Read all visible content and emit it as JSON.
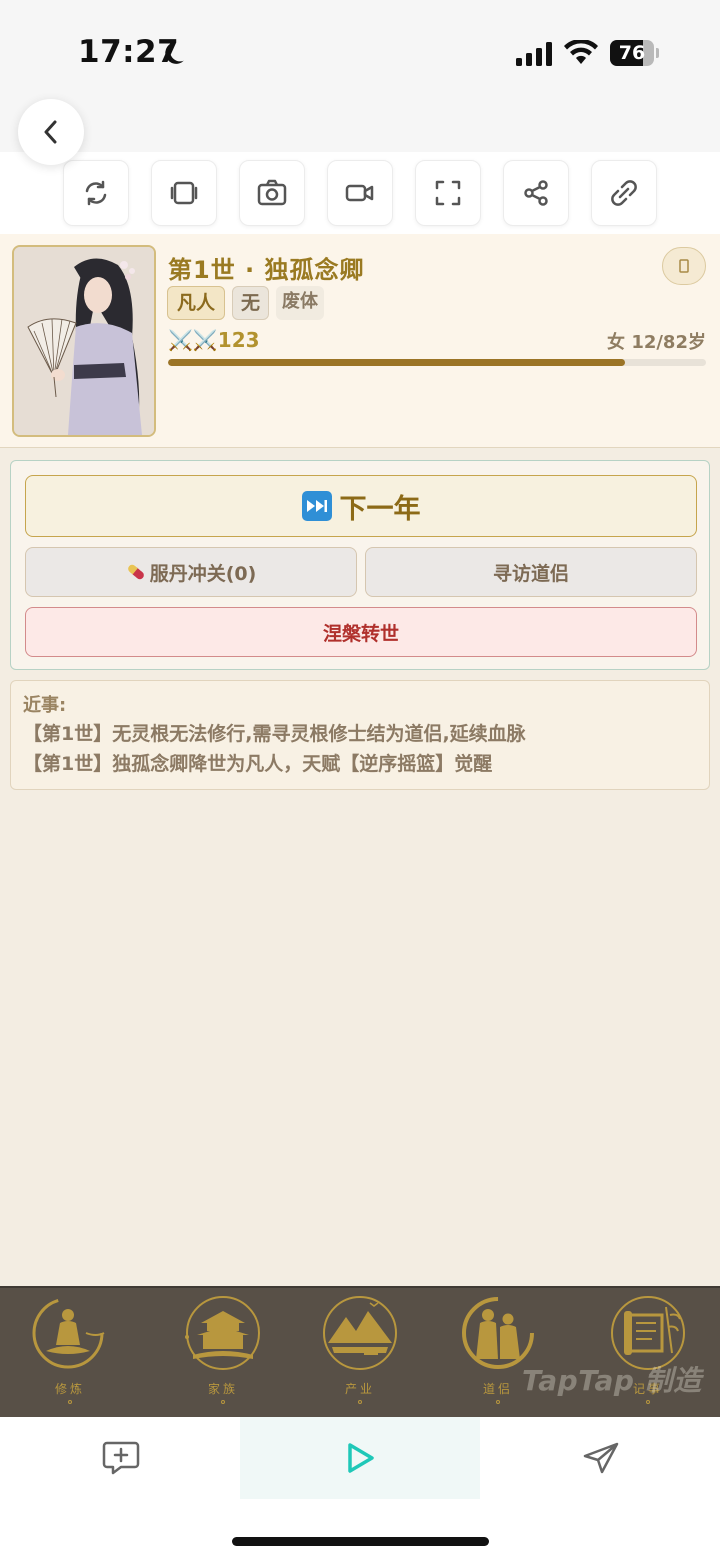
{
  "status_bar": {
    "time": "17:27",
    "battery": "76",
    "battery_level": 0.76
  },
  "profile": {
    "title": "第1世 · 独孤念卿",
    "tags": [
      "凡人",
      "无",
      "废体"
    ],
    "power": "⚔️⚔️123",
    "age": "女 12/82岁",
    "life_progress": 0.85
  },
  "actions": {
    "next_year": "下一年",
    "pill": "服丹冲关(0)",
    "seek_partner": "寻访道侣",
    "rebirth": "涅槃转世"
  },
  "events": {
    "title": "近事:",
    "lines": [
      "【第1世】无灵根无法修行,需寻灵根修士结为道侣,延续血脉",
      "【第1世】独孤念卿降世为凡人，天赋【逆序摇篮】觉醒"
    ]
  },
  "bottom_nav": {
    "items": [
      {
        "label": "修炼",
        "icon": "meditation-icon"
      },
      {
        "label": "家族",
        "icon": "pavilion-icon"
      },
      {
        "label": "产业",
        "icon": "mountain-icon"
      },
      {
        "label": "道侣",
        "icon": "couple-icon"
      },
      {
        "label": "记事",
        "icon": "scroll-icon"
      }
    ],
    "watermark": "TapTap 制造"
  },
  "colors": {
    "accent_gold": "#9a7a22",
    "rebirth_red": "#b0302c",
    "nav_bg": "#585047"
  }
}
